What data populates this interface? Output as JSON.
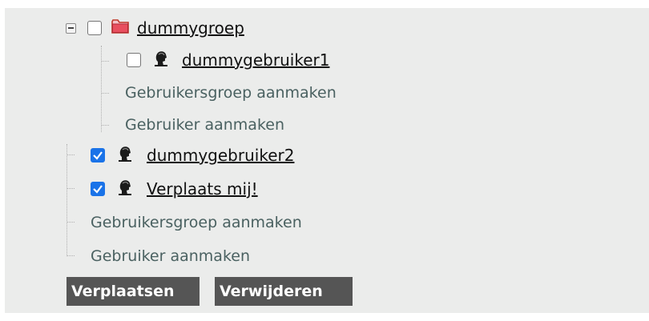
{
  "tree": {
    "group": {
      "label": "dummygroep",
      "checked": false,
      "expanded": true
    },
    "group_children": [
      {
        "label": "dummygebruiker1",
        "checked": false
      }
    ],
    "group_actions": {
      "create_group": "Gebruikersgroep aanmaken",
      "create_user": "Gebruiker aanmaken"
    },
    "users": [
      {
        "label": "dummygebruiker2",
        "checked": true
      },
      {
        "label": "Verplaats mij!",
        "checked": true
      }
    ],
    "root_actions": {
      "create_group": "Gebruikersgroep aanmaken",
      "create_user": "Gebruiker aanmaken"
    }
  },
  "buttons": {
    "move": "Verplaatsen",
    "delete": "Verwijderen"
  },
  "icons": {
    "toggle": "collapse-toggle-icon",
    "folder": "folder-icon",
    "user": "user-bust-icon"
  },
  "colors": {
    "panel_bg": "#ebeceb",
    "checkbox_checked": "#1a73e8",
    "action_text": "#4a6161",
    "button_bg": "#555555",
    "folder": "#d04a5a"
  }
}
